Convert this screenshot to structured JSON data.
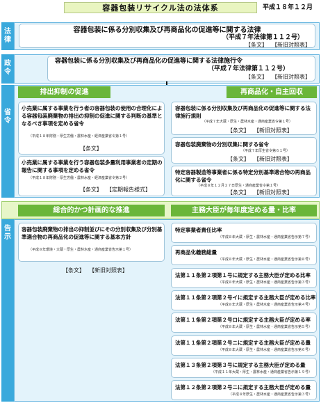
{
  "title": "容器包装リサイクル法の法体系",
  "date": "平成１８年１２月",
  "side": {
    "law": "法律",
    "cabinet": "政令",
    "ministry": "省令",
    "notice": "告示"
  },
  "law_box": {
    "line1": "容器包装に係る分別収集及び再商品化の促進等に関する法律",
    "line2": "（平成７年法律第１１２号）",
    "links": [
      "【条文】",
      "【新旧対照表】"
    ]
  },
  "cabinet_box": {
    "line1": "容器包装に係る分別収集及び再商品化の促進等に関する法律施行令",
    "line2": "（平成７年法律第１１２号）",
    "links": [
      "【条文】",
      "【新旧対照表】"
    ]
  },
  "headers": {
    "left_ministry": "排出抑制の促進",
    "right_ministry": "再商品化・自主回収",
    "left_notice": "総合的かつ計画的な推進",
    "right_notice": "主務大臣が毎年度定める量・比率"
  },
  "left_ministry_items": [
    {
      "text": "小売業に属する事業を行う者の容器包装の使用の合理化による容器包装廃棄物の排出の抑制の促進に関する判断の基準となるべき事項を定める省令",
      "note": "（平成１８年財務・厚生労働・農林水産・経済産業省令第１号）",
      "links": [
        "【条文】"
      ]
    },
    {
      "text": "小売業に属する事業を行う容器包装多量利用事業者の定期の報告に関する事項を定める省令",
      "note": "（平成１８年財務・厚生労働・農林水産・経済産業省令第２号）",
      "links": [
        "【条文】",
        "【定期報告様式】"
      ]
    }
  ],
  "right_ministry_items": [
    {
      "text": "容器包装に係る分別収集及び再商品化の促進等に関する法律施行規則",
      "note": "（平成７年大蔵・厚生・農林水産・通商産業省令第１号）",
      "links": [
        "【条文】",
        "【新旧対照表】"
      ]
    },
    {
      "text": "容器包装廃棄物の分別収集に関する省令",
      "note": "（平成７年厚生省令第６１号）",
      "links": [
        "【条文】",
        "【新旧対照表】"
      ]
    },
    {
      "text": "特定容器製造等事業者に係る特定分別基準適合物の再商品化に関する省令",
      "note": "（平成８年１２月２７日厚生・通商産業省令第１号）",
      "links": [
        "【条文】",
        "【新旧対照表】"
      ]
    }
  ],
  "left_notice_item": {
    "text": "容器包装廃棄物の排出の抑制並びにその分別収集及び分別基準適合物の再商品化の促進等に関する基本方針",
    "note": "（平成８年環境・大蔵・厚生・農林水産・通商産業省告示第１号）",
    "links": [
      "【条文】",
      "【新旧対照表】"
    ]
  },
  "right_notice_items": [
    {
      "text": "特定事業者責任比率",
      "note": "（平成８年大蔵・厚生・農林水産・通商産業省告示第７号）"
    },
    {
      "text": "再商品化義務総量",
      "note": "（平成８年大蔵・厚生・農林水産・通商産業省告示第８号）"
    },
    {
      "text": "法第１１条第２項第１号に規定する主務大臣が定める比率",
      "note": "（平成８年大蔵・厚生・農林水産・通商産業省告示第３号）"
    },
    {
      "text": "法第１１条第２項第２号イに規定する主務大臣が定める比率",
      "note": "（平成８年大蔵・厚生・農林水産・通商産業省告示第４号）"
    },
    {
      "text": "法第１１条第２項第２号ロに規定する主務大臣が定める率",
      "note": "（平成８年大蔵・厚生・農林水産・通商産業省告示第５号）"
    },
    {
      "text": "法第１１条第２項第２号ニに規定する主務大臣が定める量",
      "note": "（平成８年大蔵・厚生・農林水産・通商産業省告示第６号）"
    },
    {
      "text": "法第１３条第２項第３号に規定する主務大臣が定める量",
      "note": "（平成１１年大蔵・厚生・農林水産・通商産業省告示第１９号）"
    },
    {
      "text": "法第１２条第２項第２号ニに規定する主務大臣が定める量",
      "note": "（平成８年厚生・農林水産・通商産業省告示第３号）"
    }
  ]
}
